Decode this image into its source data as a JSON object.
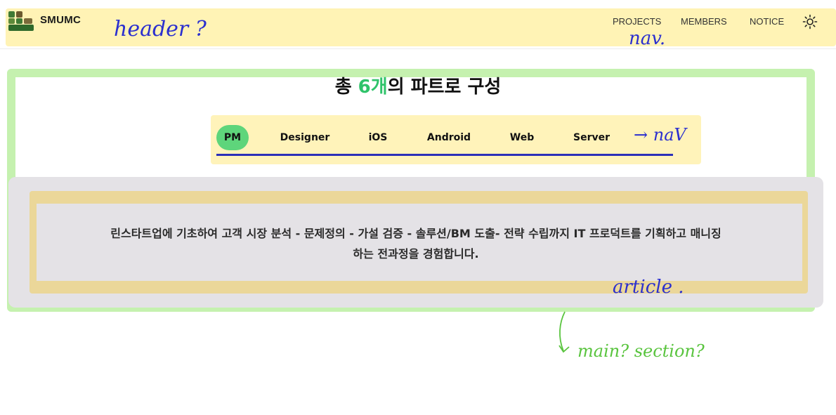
{
  "header": {
    "brand": "SMUMC",
    "nav": [
      {
        "label": "PROJECTS"
      },
      {
        "label": "MEMBERS"
      },
      {
        "label": "NOTICE"
      }
    ],
    "theme_icon": "sun-icon",
    "logo_icon": "smumc-logo"
  },
  "section": {
    "title_prefix": "총 ",
    "title_accent": "6개",
    "title_suffix": "의 파트로 구성",
    "accent_color": "#2fc36a",
    "tabs": [
      {
        "label": "PM",
        "active": true
      },
      {
        "label": "Designer",
        "active": false
      },
      {
        "label": "iOS",
        "active": false
      },
      {
        "label": "Android",
        "active": false
      },
      {
        "label": "Web",
        "active": false
      },
      {
        "label": "Server",
        "active": false
      }
    ],
    "active_tab_color": "#5ed57b",
    "description_line1": "린스타트업에 기초하여 고객 시장 분석 - 문제정의 - 가설 검증 - 솔루션/BM 도출- 전략 수립까지 IT 프로덕트를 기획하고 매니징",
    "description_line2": "하는 전과정을 경험합니다."
  },
  "annotations": {
    "header": "header ?",
    "nav_top": "nav.",
    "nav_tabs": "→ naV",
    "article": "article .",
    "main_section": "main?  section?"
  }
}
